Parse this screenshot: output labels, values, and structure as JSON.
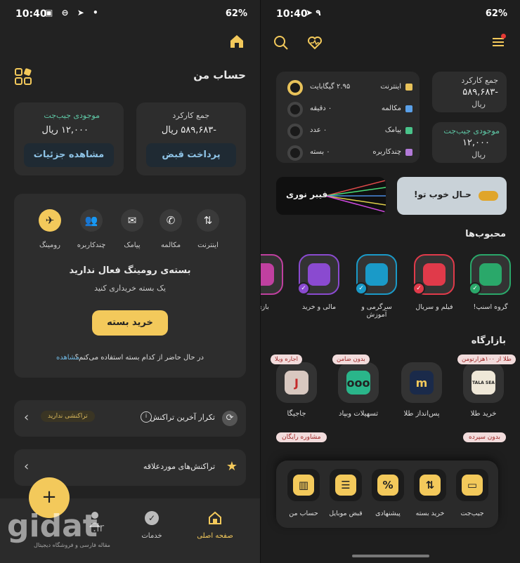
{
  "status_left": {
    "time": "10:40",
    "battery": "62%",
    "icons": "▣ ⊖ ➤ •"
  },
  "status_right": {
    "time": "10:40",
    "battery": "62%",
    "icons": "➤ ٩"
  },
  "left": {
    "header_title": "حساب من",
    "bill_card": {
      "label": "جمع کارکرد",
      "amount": "-۵۸۹,۶۸۳ ریال",
      "button": "پرداخت قبض"
    },
    "wallet_card": {
      "label": "موجودی جیب‌جت",
      "amount": "۱۲,۰۰۰ ریال",
      "button": "مشاهده جزئیات"
    },
    "tabs": [
      {
        "label": "اینترنت",
        "icon": "internet-icon"
      },
      {
        "label": "مکالمه",
        "icon": "phone-icon"
      },
      {
        "label": "پیامک",
        "icon": "sms-icon"
      },
      {
        "label": "چندکاربره",
        "icon": "users-icon"
      },
      {
        "label": "رومینگ",
        "icon": "plane-icon"
      }
    ],
    "roaming_title": "بسته‌ی رومینگ فعال ندارید",
    "roaming_sub": "یک بسته خریداری کنید",
    "buy_button": "خرید بسته",
    "which_package": "در حال حاضر از کدام بسته استفاده می‌کنم؟",
    "view_link": "مشاهده",
    "repeat_tx": "تکرار آخرین تراکنش",
    "no_tx_badge": "تراکنشی ندارید",
    "favorites_tx": "تراکنش‌های موردعلاقه",
    "nav": [
      {
        "label": "صفحه اصلی"
      },
      {
        "label": "خدمات"
      }
    ],
    "fab": "+"
  },
  "right": {
    "bill_label": "جمع کارکرد",
    "bill_amount": "-۵۸۹,۶۸۳",
    "bill_unit": "ریال",
    "wallet_label": "موجودی جیب‌جت",
    "wallet_amount": "۱۲,۰۰۰",
    "wallet_unit": "ریال",
    "usage": [
      {
        "label": "اینترنت",
        "value": "۲.۹۵ گیگابایت",
        "color": "#e8c25a"
      },
      {
        "label": "مکالمه",
        "value": "۰ دقیقه",
        "color": "#5aa0e8"
      },
      {
        "label": "پیامک",
        "value": "۰ عدد",
        "color": "#49c38a"
      },
      {
        "label": "چندکاربره",
        "value": "۰ بسته",
        "color": "#b27ad8"
      }
    ],
    "banner1": "حـال خوب تو!",
    "banner2": "فیبر نوری",
    "fav_title": "محبوب‌ها",
    "favorites": [
      {
        "label": "گروه اسنپ!",
        "color": "#2aa86a"
      },
      {
        "label": "فیلم و سریال",
        "color": "#e03a4a"
      },
      {
        "label": "سرگرمی و آموزش",
        "color": "#1a9ac8"
      },
      {
        "label": "مالی و خرید",
        "color": "#8a4ad0"
      },
      {
        "label": "بازی",
        "color": "#c040a0"
      }
    ],
    "market_title": "بازارگاه",
    "market": [
      {
        "label": "خرید طلا",
        "badge": "طلا از ۱۰۰هزارتومن",
        "logo": "TALA SEA"
      },
      {
        "label": "پس‌انداز طلا",
        "badge": "",
        "logo": "m"
      },
      {
        "label": "تسهیلات وبپاد",
        "badge": "بدون ضامن",
        "logo": "ooo"
      },
      {
        "label": "جاجیگا",
        "badge": "اجاره ویلا",
        "logo": "J"
      }
    ],
    "market2_badges": [
      "بدون سپرده",
      "مشاوره رایگان"
    ],
    "quick": [
      {
        "label": "جیب‌جت"
      },
      {
        "label": "خرید بسته"
      },
      {
        "label": "پیشنهادی"
      },
      {
        "label": "قبض موبایل"
      },
      {
        "label": "حساب من"
      }
    ]
  },
  "watermark": {
    "brand": "gidat",
    "tld": ".ir",
    "tagline": "مقاله فارسی و فروشگاه دیجیتال"
  }
}
